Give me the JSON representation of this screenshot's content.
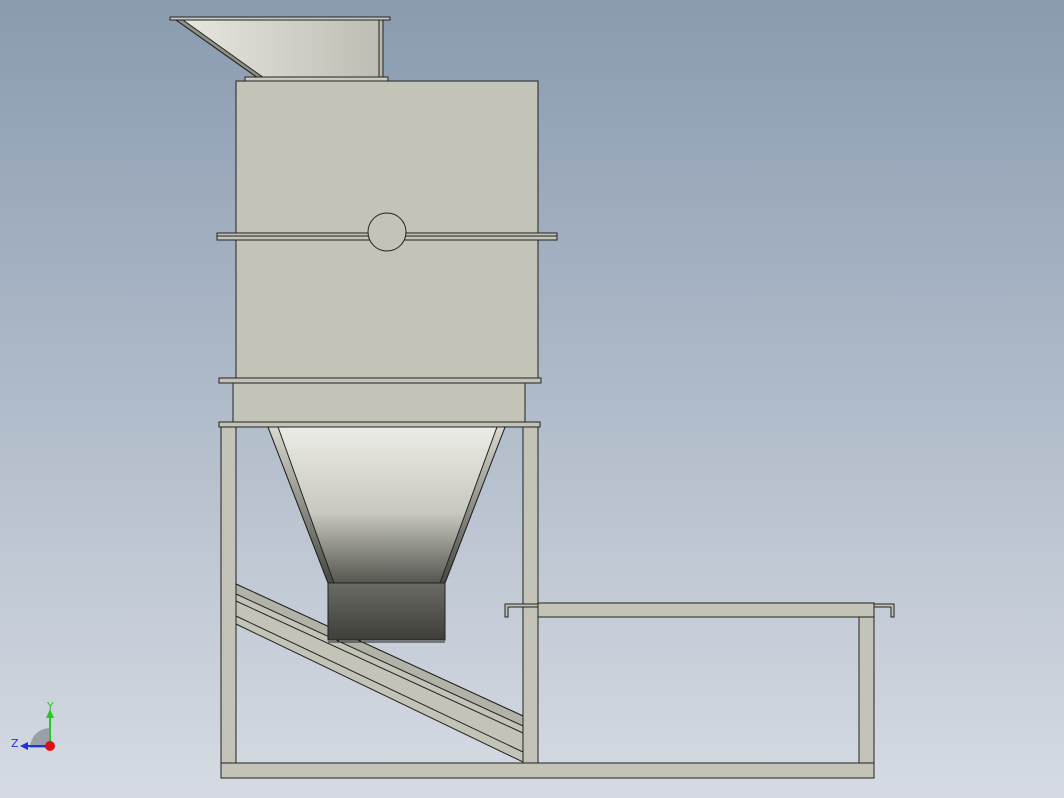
{
  "viewport": {
    "background_top": "#8a9bb0",
    "background_bottom": "#d6dbe3"
  },
  "model": {
    "body_fill": "#c3c3b8",
    "edge_color": "#222222",
    "hopper_light": "#ecece6",
    "hopper_dark": "#55564f",
    "outlet_fill": "#5a5b56"
  },
  "triad": {
    "y_label": "Y",
    "z_label": "Z",
    "y_color": "#22cc22",
    "z_color": "#2233dd",
    "x_color": "#dd1111"
  }
}
